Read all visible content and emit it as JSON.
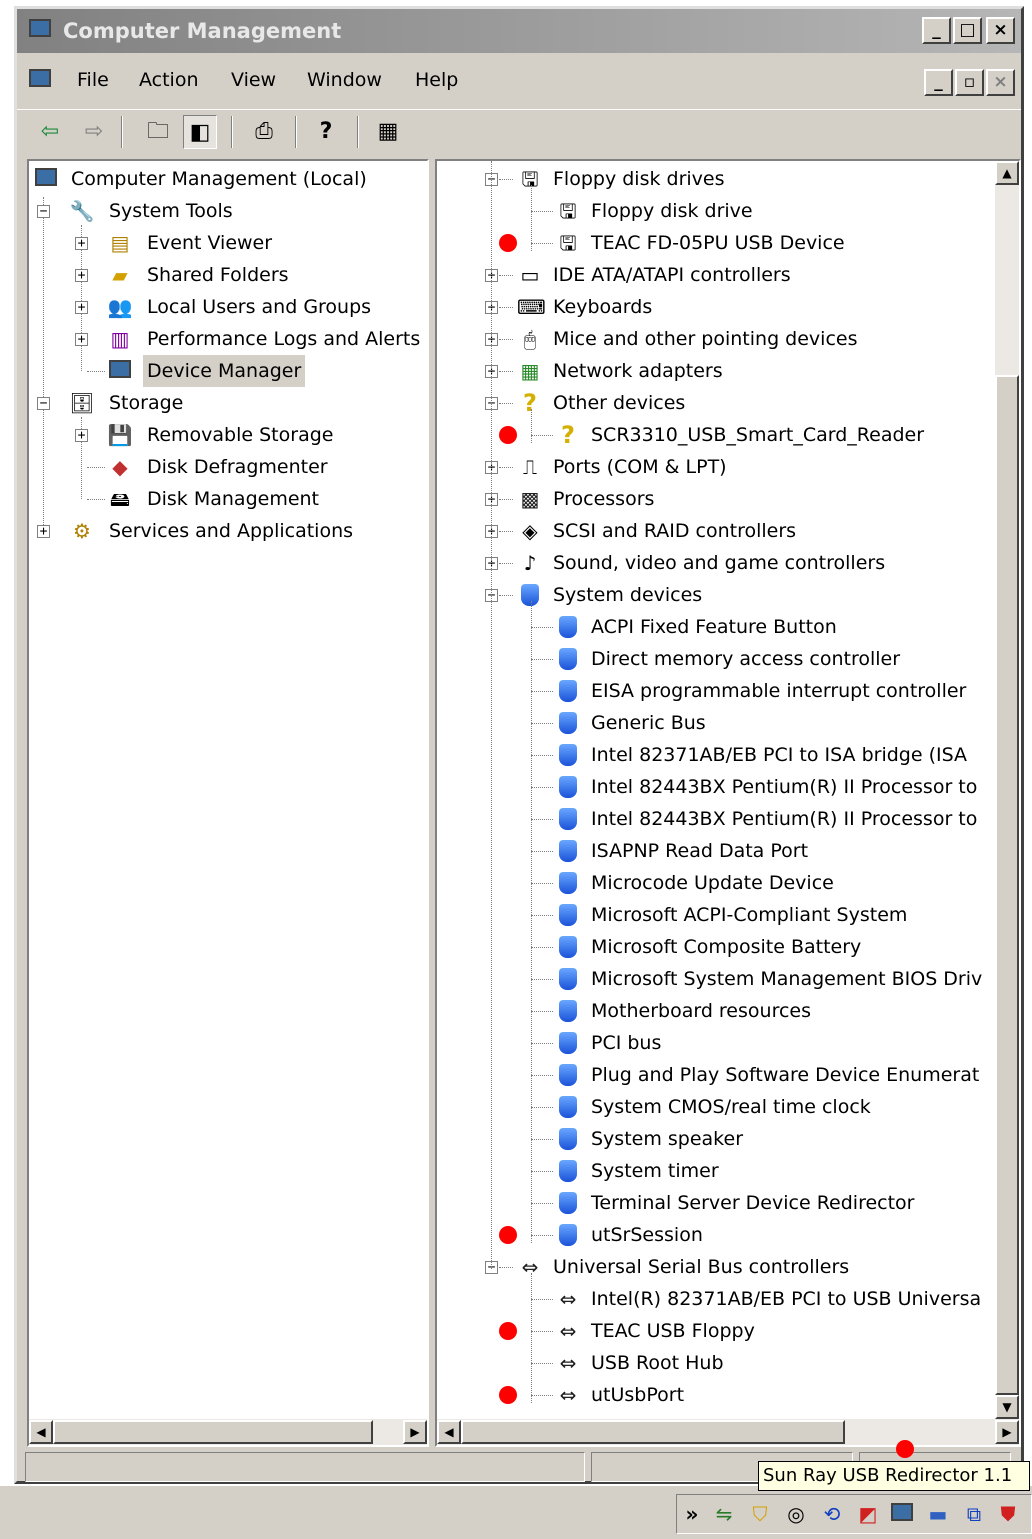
{
  "window": {
    "title": "Computer Management",
    "controls": [
      "_",
      "□",
      "×"
    ],
    "inner_controls": [
      "_",
      "▫",
      "×"
    ]
  },
  "menu": {
    "items": [
      "File",
      "Action",
      "View",
      "Window",
      "Help"
    ]
  },
  "toolbar": {
    "icons": [
      "back-arrow-icon",
      "forward-arrow-icon",
      "up-folder-icon",
      "show-hide-tree-icon",
      "print-icon",
      "help-icon",
      "properties-icon"
    ]
  },
  "left_tree": {
    "root": "Computer Management (Local)",
    "system_tools": "System Tools",
    "event_viewer": "Event Viewer",
    "shared_folders": "Shared Folders",
    "local_users": "Local Users and Groups",
    "perf_logs": "Performance Logs and Alerts",
    "device_manager": "Device Manager",
    "storage": "Storage",
    "removable_storage": "Removable Storage",
    "disk_defrag": "Disk Defragmenter",
    "disk_mgmt": "Disk Management",
    "services_apps": "Services and Applications"
  },
  "device_tree": {
    "rows": [
      {
        "label": "Floppy disk drives",
        "level": 0,
        "expander": "-",
        "icon": "floppy-drive-icon"
      },
      {
        "label": "Floppy disk drive",
        "level": 1,
        "icon": "floppy-drive-icon"
      },
      {
        "label": "TEAC FD-05PU USB Device",
        "level": 1,
        "icon": "floppy-drive-icon",
        "marked": true
      },
      {
        "label": "IDE ATA/ATAPI controllers",
        "level": 0,
        "expander": "+",
        "icon": "ide-controller-icon"
      },
      {
        "label": "Keyboards",
        "level": 0,
        "expander": "+",
        "icon": "keyboard-icon"
      },
      {
        "label": "Mice and other pointing devices",
        "level": 0,
        "expander": "+",
        "icon": "mouse-icon"
      },
      {
        "label": "Network adapters",
        "level": 0,
        "expander": "+",
        "icon": "network-adapter-icon"
      },
      {
        "label": "Other devices",
        "level": 0,
        "expander": "-",
        "icon": "unknown-device-icon"
      },
      {
        "label": "SCR3310_USB_Smart_Card_Reader",
        "level": 1,
        "icon": "unknown-device-warning-icon",
        "marked": true
      },
      {
        "label": "Ports (COM & LPT)",
        "level": 0,
        "expander": "+",
        "icon": "port-icon"
      },
      {
        "label": "Processors",
        "level": 0,
        "expander": "+",
        "icon": "processor-icon"
      },
      {
        "label": "SCSI and RAID controllers",
        "level": 0,
        "expander": "+",
        "icon": "scsi-icon"
      },
      {
        "label": "Sound, video and game controllers",
        "level": 0,
        "expander": "+",
        "icon": "sound-icon"
      },
      {
        "label": "System devices",
        "level": 0,
        "expander": "-",
        "icon": "system-device-icon"
      },
      {
        "label": "ACPI Fixed Feature Button",
        "level": 1,
        "icon": "system-device-icon"
      },
      {
        "label": "Direct memory access controller",
        "level": 1,
        "icon": "system-device-icon"
      },
      {
        "label": "EISA programmable interrupt controller",
        "level": 1,
        "icon": "system-device-icon"
      },
      {
        "label": "Generic Bus",
        "level": 1,
        "icon": "system-device-icon"
      },
      {
        "label": "Intel 82371AB/EB PCI to ISA bridge (ISA",
        "level": 1,
        "icon": "system-device-icon"
      },
      {
        "label": "Intel 82443BX Pentium(R) II Processor to",
        "level": 1,
        "icon": "system-device-icon"
      },
      {
        "label": "Intel 82443BX Pentium(R) II Processor to",
        "level": 1,
        "icon": "system-device-icon"
      },
      {
        "label": "ISAPNP Read Data Port",
        "level": 1,
        "icon": "system-device-icon"
      },
      {
        "label": "Microcode Update Device",
        "level": 1,
        "icon": "system-device-icon"
      },
      {
        "label": "Microsoft ACPI-Compliant System",
        "level": 1,
        "icon": "system-device-icon"
      },
      {
        "label": "Microsoft Composite Battery",
        "level": 1,
        "icon": "system-device-icon"
      },
      {
        "label": "Microsoft System Management BIOS Driv",
        "level": 1,
        "icon": "system-device-icon"
      },
      {
        "label": "Motherboard resources",
        "level": 1,
        "icon": "system-device-icon"
      },
      {
        "label": "PCI bus",
        "level": 1,
        "icon": "system-device-icon"
      },
      {
        "label": "Plug and Play Software Device Enumerat",
        "level": 1,
        "icon": "system-device-icon"
      },
      {
        "label": "System CMOS/real time clock",
        "level": 1,
        "icon": "system-device-icon"
      },
      {
        "label": "System speaker",
        "level": 1,
        "icon": "system-device-icon"
      },
      {
        "label": "System timer",
        "level": 1,
        "icon": "system-device-icon"
      },
      {
        "label": "Terminal Server Device Redirector",
        "level": 1,
        "icon": "system-device-icon"
      },
      {
        "label": "utSrSession",
        "level": 1,
        "icon": "system-device-icon",
        "marked": true
      },
      {
        "label": "Universal Serial Bus controllers",
        "level": 0,
        "expander": "-",
        "icon": "usb-icon"
      },
      {
        "label": "Intel(R) 82371AB/EB PCI to USB Universa",
        "level": 1,
        "icon": "usb-icon"
      },
      {
        "label": "TEAC USB Floppy",
        "level": 1,
        "icon": "usb-icon",
        "marked": true
      },
      {
        "label": "USB Root Hub",
        "level": 1,
        "icon": "usb-icon"
      },
      {
        "label": "utUsbPort",
        "level": 1,
        "icon": "usb-icon",
        "marked": true
      }
    ]
  },
  "taskbar": {
    "chevron": "»",
    "tooltip": "Sun Ray USB Redirector 1.1",
    "tray_icons": [
      "network-icon",
      "shield-icon",
      "speaker-icon",
      "refresh-icon",
      "flag-icon",
      "monitor-icon",
      "usb-drive-icon",
      "window-icon",
      "alert-icon"
    ]
  },
  "colors": {
    "marker": "#ff0000",
    "title_bar": "#818181",
    "face": "#d4d0c8"
  }
}
